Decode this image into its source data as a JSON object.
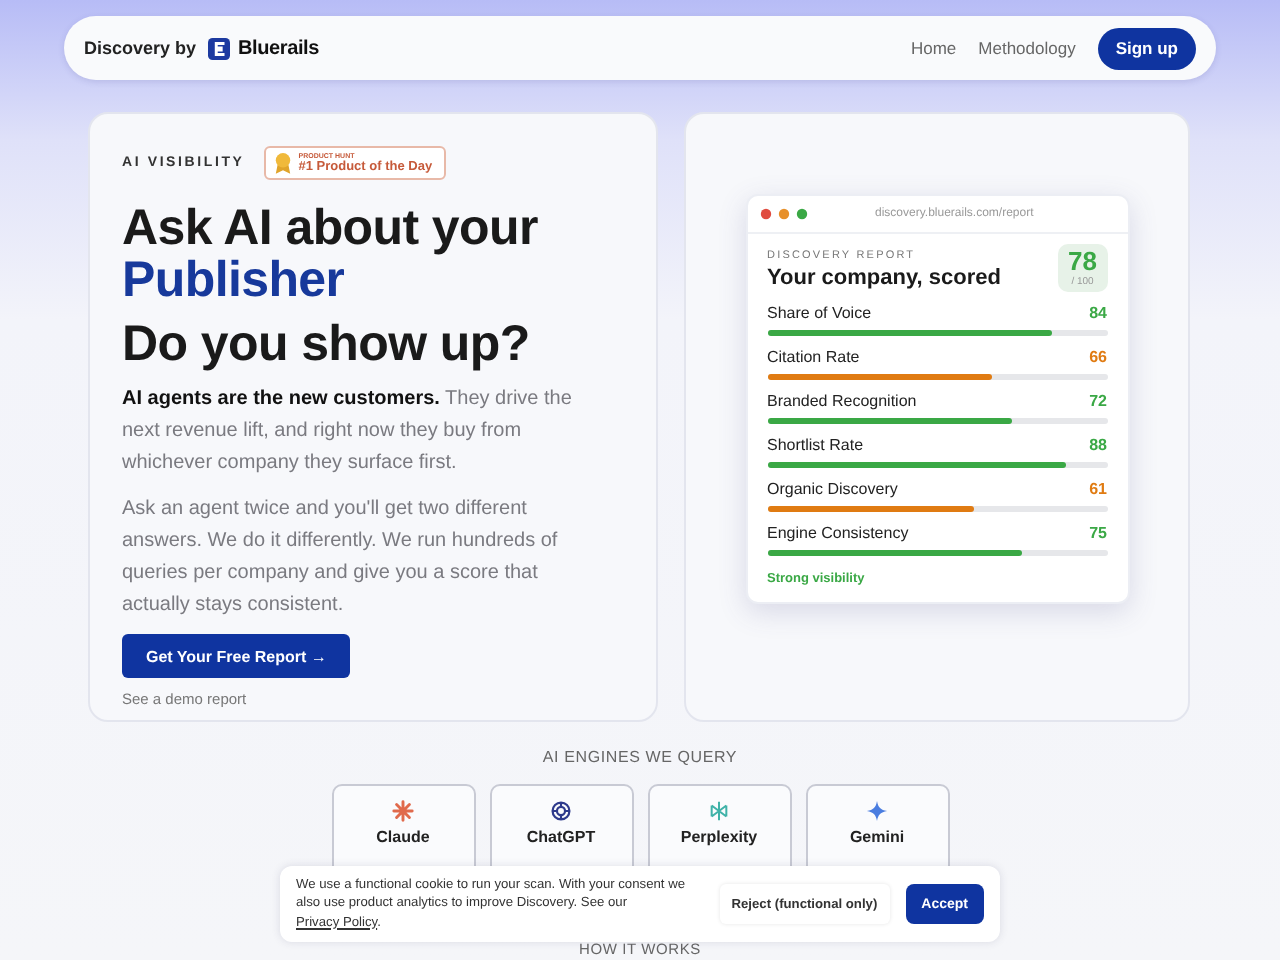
{
  "nav": {
    "brand_prefix": "Discovery by",
    "brand_name": "Bluerails",
    "links": [
      {
        "label": "Home"
      },
      {
        "label": "Methodology"
      }
    ],
    "cta": "Sign up"
  },
  "hero": {
    "eyebrow": "AI VISIBILITY",
    "award": {
      "small": "PRODUCT HUNT",
      "label": "#1 Product of the Day"
    },
    "title_line": "Ask AI about your",
    "highlight": "Publisher",
    "title_line2": "Do you show up?",
    "paragraphs": [
      "**AI agents are the new customers.** They drive the next revenue lift, and right now they buy from whichever company they surface first.",
      "Ask an agent twice and you'll get two different answers. We do it differently. We run hundreds of queries per company and give you a score that actually stays consistent."
    ],
    "cta": "Get Your Free Report →",
    "secondary_link": "See a demo report"
  },
  "report": {
    "url": "discovery.bluerails.com/report",
    "eyebrow": "DISCOVERY REPORT",
    "title": "Your company, scored",
    "score": "78",
    "score_max": "/ 100",
    "metrics": [
      {
        "name": "Share of Voice",
        "value": "84",
        "level": 0.84,
        "color": "#3aa845"
      },
      {
        "name": "Citation Rate",
        "value": "66",
        "level": 0.66,
        "color": "#e07b12"
      },
      {
        "name": "Branded Recognition",
        "value": "72",
        "level": 0.72,
        "color": "#3aa845"
      },
      {
        "name": "Shortlist Rate",
        "value": "88",
        "level": 0.88,
        "color": "#3aa845"
      },
      {
        "name": "Organic Discovery",
        "value": "61",
        "level": 0.61,
        "color": "#e07b12"
      },
      {
        "name": "Engine Consistency",
        "value": "75",
        "level": 0.75,
        "color": "#3aa845"
      }
    ],
    "verdict": "Strong visibility"
  },
  "engines": {
    "heading": "AI ENGINES WE QUERY",
    "items": [
      {
        "name": "Claude",
        "kind": "burst"
      },
      {
        "name": "ChatGPT",
        "kind": "knot"
      },
      {
        "name": "Perplexity",
        "kind": "lattice"
      },
      {
        "name": "Gemini",
        "kind": "sparkle"
      }
    ]
  },
  "next_heading": "HOW IT WORKS",
  "cookie": {
    "text": "We use a functional cookie to run your scan. With your consent we also use product analytics to improve Discovery. See our",
    "link": "Privacy Policy",
    "end": ".",
    "reject": "Reject (functional only)",
    "accept": "Accept"
  }
}
